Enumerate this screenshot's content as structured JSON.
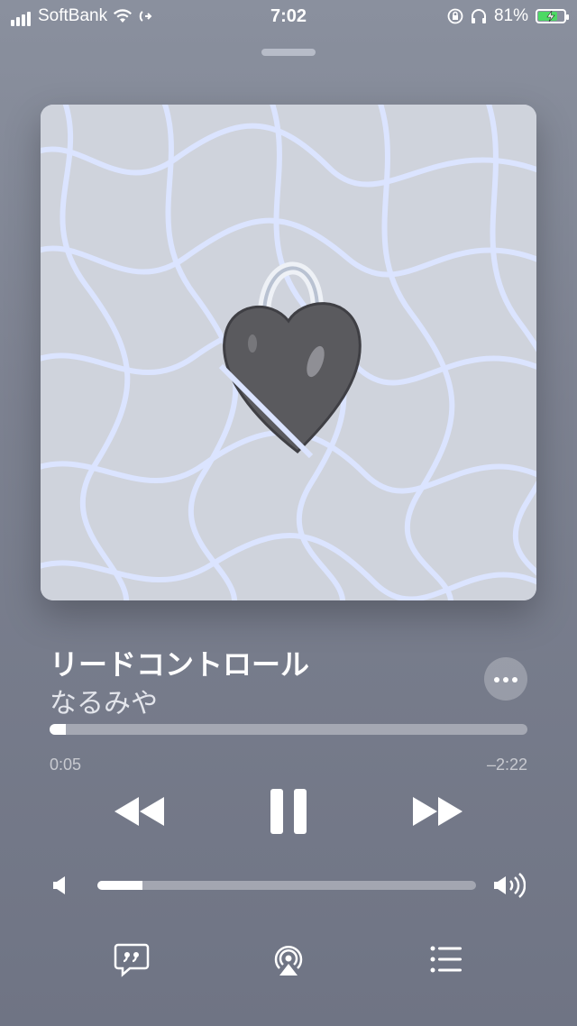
{
  "status_bar": {
    "carrier": "SoftBank",
    "time": "7:02",
    "battery_percent": "81%",
    "battery_level": 0.81,
    "icons": [
      "signal-icon",
      "wifi-icon",
      "call-forwarding-icon",
      "orientation-lock-icon",
      "headphones-icon",
      "battery-charging-icon"
    ]
  },
  "now_playing": {
    "title": "リードコントロール",
    "artist": "なるみや",
    "elapsed": "0:05",
    "remaining": "–2:22",
    "progress": 0.034,
    "volume": 0.12
  },
  "controls": {
    "icons": [
      "rewind-icon",
      "pause-icon",
      "fast-forward-icon",
      "volume-low-icon",
      "volume-high-icon",
      "more-icon"
    ]
  },
  "bottom_bar": {
    "icons": [
      "lyrics-icon",
      "airplay-icon",
      "queue-icon"
    ]
  },
  "colors": {
    "background_top": "#8a909e",
    "background_bottom": "#6f7484",
    "art_background": "#cfd3dc",
    "net_lines": "#dbe4ff",
    "battery_fill": "#4cd964"
  }
}
